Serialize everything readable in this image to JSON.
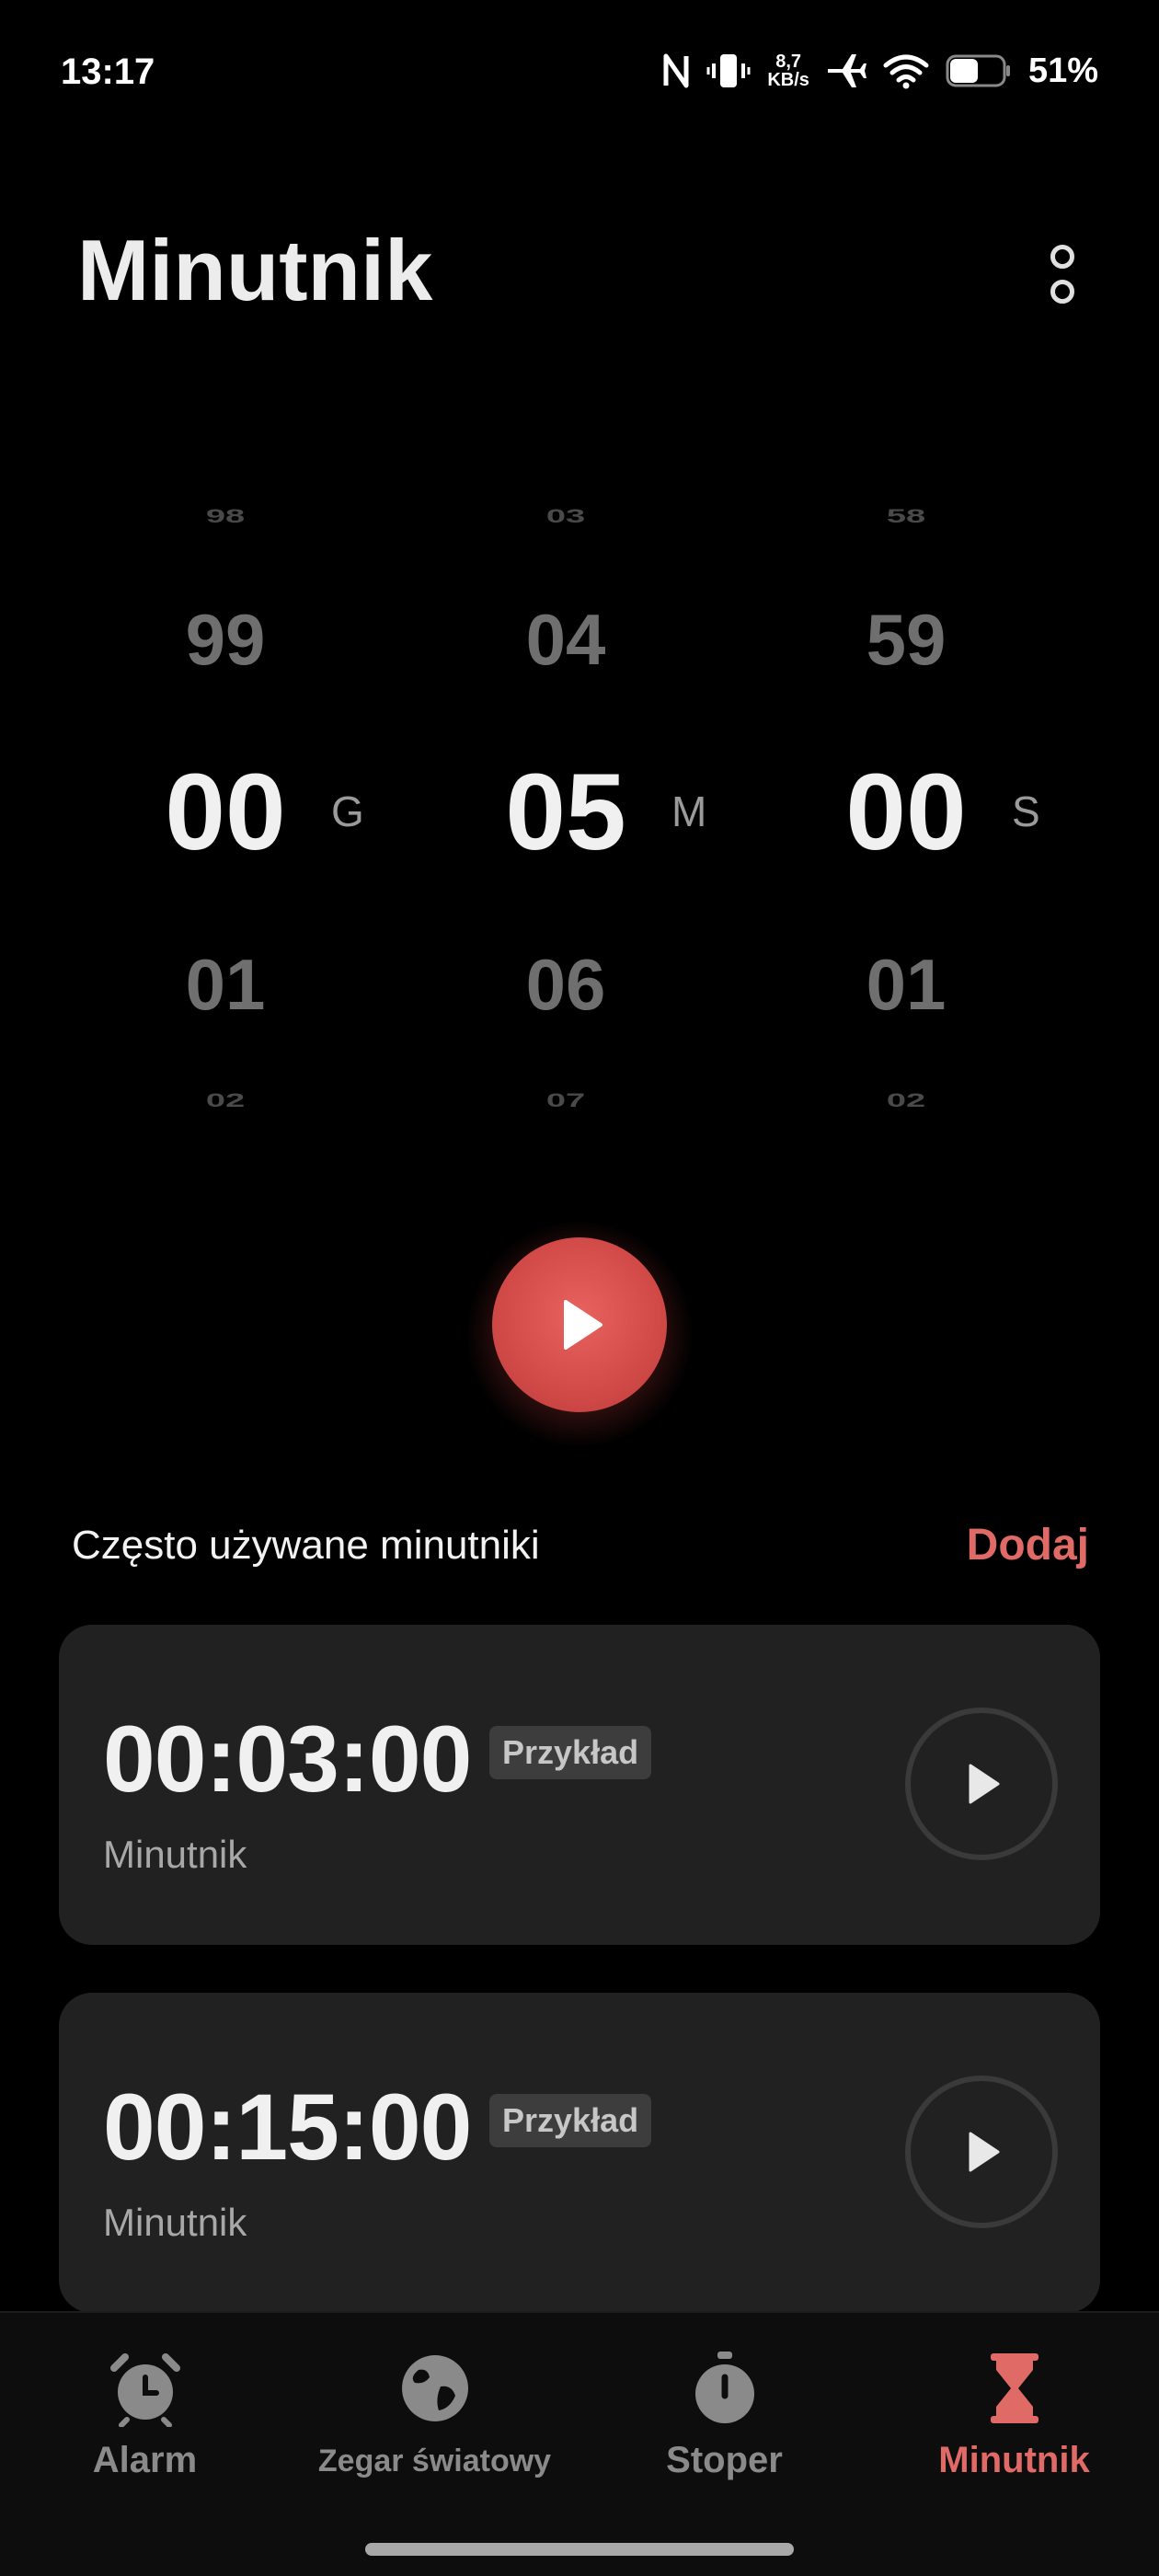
{
  "status_bar": {
    "time": "13:17",
    "net_speed_value": "8,7",
    "net_speed_unit": "KB/s",
    "battery": "51%",
    "icons": [
      "nfc-icon",
      "vibrate-icon",
      "airplane-icon",
      "wifi-icon",
      "battery-icon"
    ]
  },
  "header": {
    "title": "Minutnik",
    "more_icon": "more-vertical-icon"
  },
  "picker": {
    "hours": {
      "above2": "98",
      "above1": "99",
      "selected": "00",
      "below1": "01",
      "below2": "02",
      "unit": "G"
    },
    "minutes": {
      "above2": "03",
      "above1": "04",
      "selected": "05",
      "below1": "06",
      "below2": "07",
      "unit": "M"
    },
    "seconds": {
      "above2": "58",
      "above1": "59",
      "selected": "00",
      "below1": "01",
      "below2": "02",
      "unit": "S"
    }
  },
  "start_button": {
    "icon": "play-icon"
  },
  "frequent": {
    "title": "Często używane minutniki",
    "add_label": "Dodaj",
    "items": [
      {
        "time": "00:03:00",
        "badge": "Przykład",
        "label": "Minutnik"
      },
      {
        "time": "00:15:00",
        "badge": "Przykład",
        "label": "Minutnik"
      }
    ]
  },
  "nav": {
    "items": [
      {
        "label": "Alarm",
        "icon": "alarm-clock-icon"
      },
      {
        "label": "Zegar światowy",
        "icon": "globe-icon"
      },
      {
        "label": "Stoper",
        "icon": "stopwatch-icon"
      },
      {
        "label": "Minutnik",
        "icon": "hourglass-icon"
      }
    ],
    "active": "Minutnik"
  },
  "colors": {
    "accent": "#e06a66",
    "card_bg": "#212121",
    "background": "#000000"
  }
}
